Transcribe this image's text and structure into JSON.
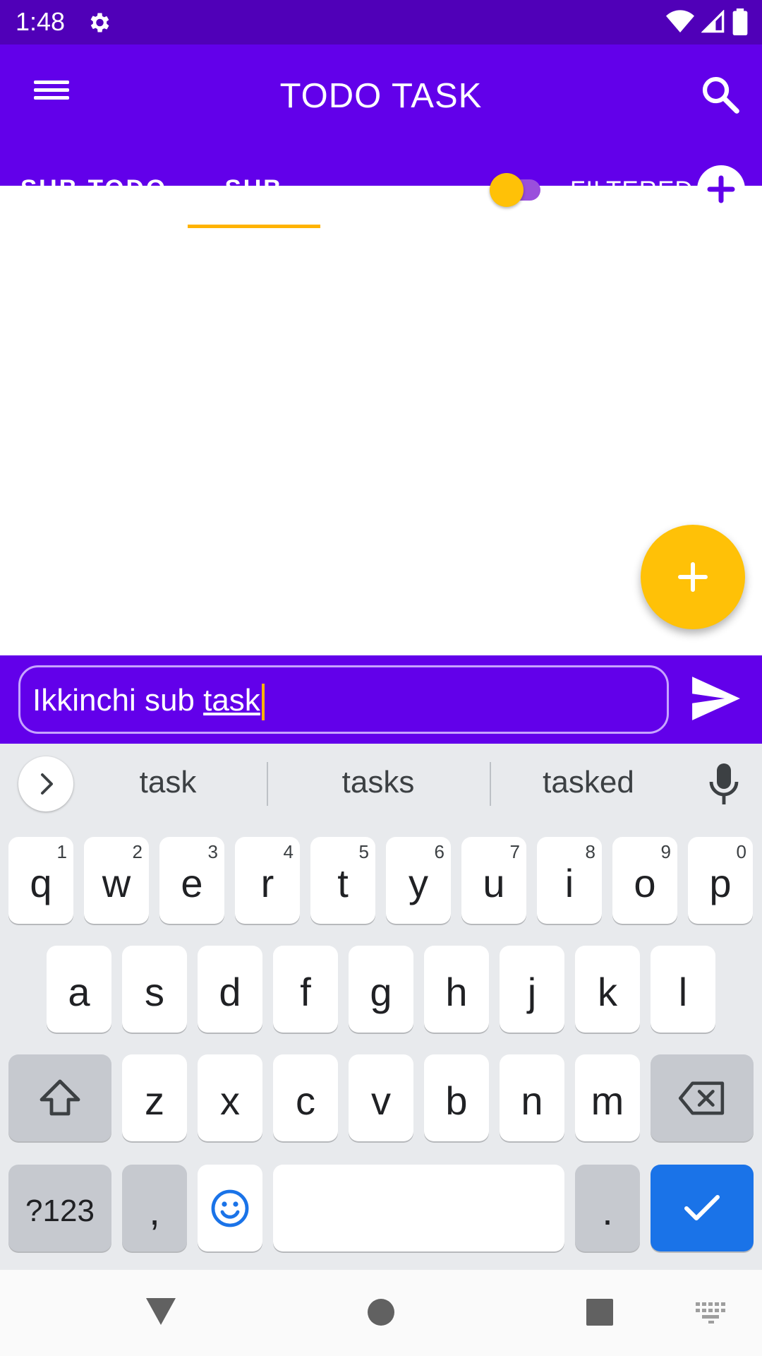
{
  "status_bar": {
    "time": "1:48",
    "icons": [
      "settings-icon",
      "wifi-icon",
      "cell-signal-icon",
      "battery-icon"
    ]
  },
  "app_bar": {
    "title": "TODO TASK",
    "menu_icon": "menu-icon",
    "search_icon": "search-icon"
  },
  "tabs": [
    {
      "label": "SUB TODO",
      "selected": false
    },
    {
      "label": "SUB",
      "selected": true
    }
  ],
  "filter": {
    "label": "FILTERED",
    "toggle_on": false,
    "add_icon": "add-circle-icon"
  },
  "fab": {
    "icon": "add-icon"
  },
  "input": {
    "value_prefix": "Ikkinchi sub ",
    "value_word": "task",
    "send_icon": "send-icon"
  },
  "keyboard": {
    "suggestions": [
      "task",
      "tasks",
      "tasked"
    ],
    "row1": [
      {
        "key": "q",
        "hint": "1"
      },
      {
        "key": "w",
        "hint": "2"
      },
      {
        "key": "e",
        "hint": "3"
      },
      {
        "key": "r",
        "hint": "4"
      },
      {
        "key": "t",
        "hint": "5"
      },
      {
        "key": "y",
        "hint": "6"
      },
      {
        "key": "u",
        "hint": "7"
      },
      {
        "key": "i",
        "hint": "8"
      },
      {
        "key": "o",
        "hint": "9"
      },
      {
        "key": "p",
        "hint": "0"
      }
    ],
    "row2": [
      "a",
      "s",
      "d",
      "f",
      "g",
      "h",
      "j",
      "k",
      "l"
    ],
    "row3": [
      "z",
      "x",
      "c",
      "v",
      "b",
      "n",
      "m"
    ],
    "symbols_label": "?123",
    "comma_label": ",",
    "period_label": ".",
    "colors": {
      "action": "#1a73e8",
      "keyboard_bg": "#e8eaed"
    }
  },
  "colors": {
    "primary": "#6200ea",
    "status_bar": "#5000b8",
    "accent": "#ffc107"
  }
}
